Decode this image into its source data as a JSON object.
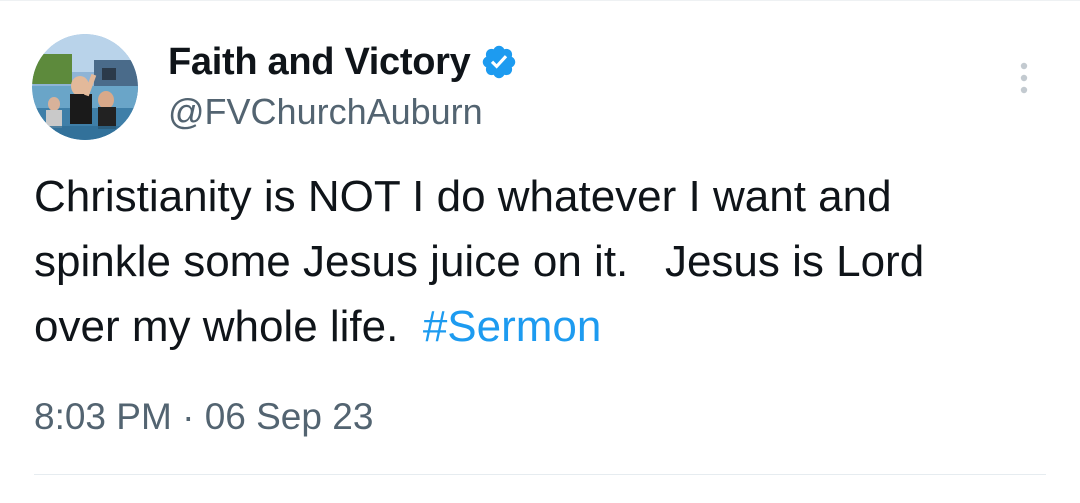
{
  "author": {
    "display_name": "Faith and Victory",
    "handle": "@FVChurchAuburn",
    "verified": true,
    "avatar_icon": "profile-photo",
    "verified_icon": "verified-badge-icon"
  },
  "tweet": {
    "text_lines": [
      "Christianity is NOT I do whatever I want and",
      "spinkle some Jesus juice on it.   Jesus is Lord",
      "over my whole life.  "
    ],
    "hashtag": "#Sermon"
  },
  "meta": {
    "time": "8:03 PM",
    "separator": "·",
    "date": "06 Sep 23"
  },
  "colors": {
    "link": "#1d9bf0",
    "secondary_text": "#536471",
    "verified_badge": "#1d9bf0"
  },
  "icons": {
    "more_menu": "more-vertical-icon"
  }
}
